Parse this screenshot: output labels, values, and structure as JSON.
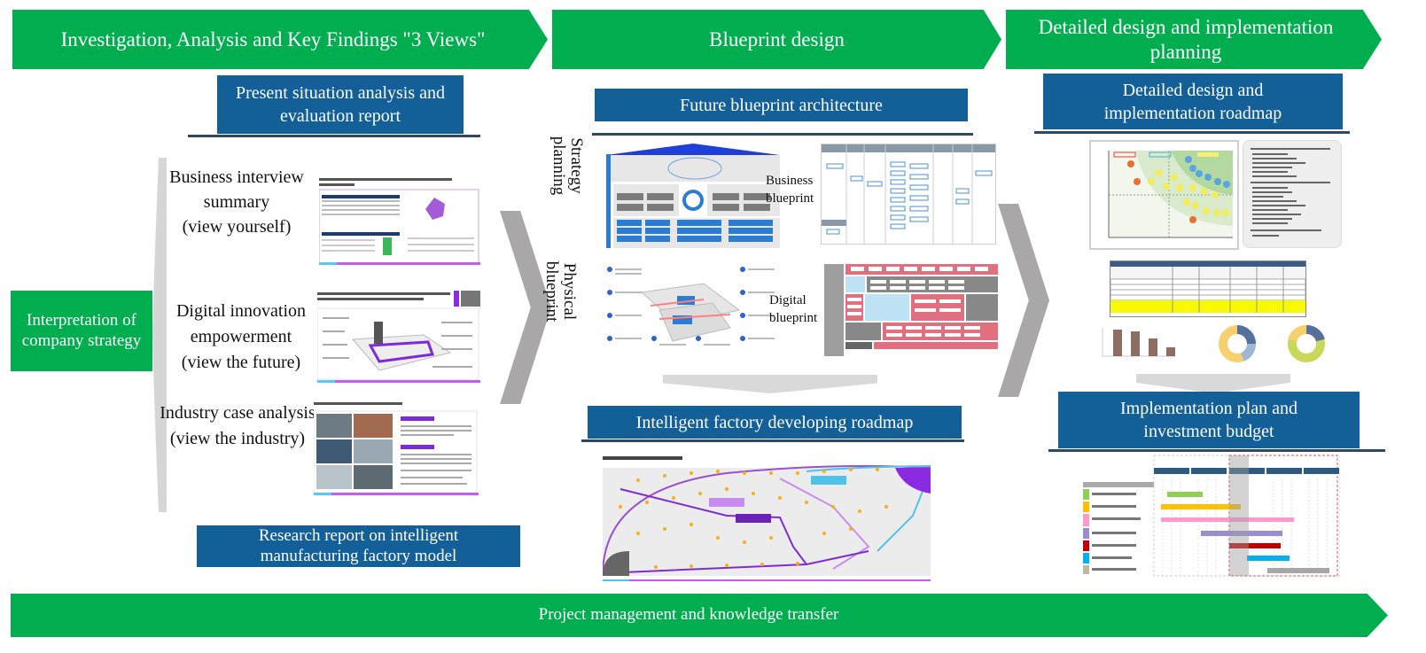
{
  "phases": [
    {
      "label": "Investigation, Analysis and Key Findings \"3 Views\""
    },
    {
      "label": "Blueprint design"
    },
    {
      "label": "Detailed design and implementation planning"
    }
  ],
  "column1": {
    "top_report": "Present situation analysis and evaluation report",
    "strategy_box": "Interpretation of company strategy",
    "views": [
      {
        "title": "Business interview summary",
        "sub": "(view yourself)",
        "thumb": "interview-summary-slide"
      },
      {
        "title": "Digital innovation empowerment",
        "sub": "(view the future)",
        "thumb": "digital-innovation-slide"
      },
      {
        "title": "Industry case analysis",
        "sub": "(view the industry)",
        "thumb": "industry-case-slide"
      }
    ],
    "bottom_report": "Research report on intelligent manufacturing factory model"
  },
  "column2": {
    "top_box": "Future blueprint architecture",
    "row_labels": [
      "Strategy planning",
      "Physical blueprint"
    ],
    "blueprint_labels": [
      "Business blueprint",
      "Digital blueprint"
    ],
    "roadmap_box": "Intelligent factory developing roadmap"
  },
  "column3": {
    "top_box": "Detailed design and implementation roadmap",
    "budget_box": "Implementation plan and investment budget"
  },
  "footer": {
    "label": "Project management and knowledge transfer"
  },
  "colors": {
    "phase_green": "#00ae4f",
    "box_blue": "#135f98",
    "arrow_gray": "#a9a7a7"
  }
}
